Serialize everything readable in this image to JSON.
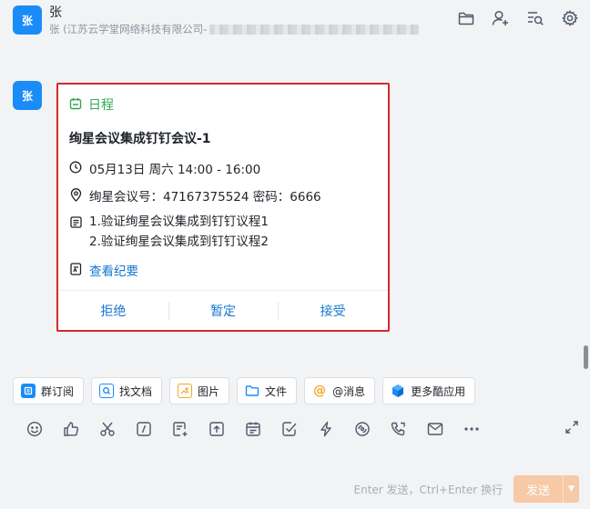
{
  "header": {
    "name": "张",
    "subtitle": "张 (江苏云学堂网络科技有限公司-",
    "avatar_text": "张",
    "icons": [
      "folder-icon",
      "add-user-icon",
      "search-history-icon",
      "settings-icon"
    ]
  },
  "message": {
    "avatar_text": "张",
    "card": {
      "type_label": "日程",
      "title": "绚星会议集成钉钉会议-1",
      "time": "05月13日 周六 14:00 - 16:00",
      "location": "绚星会议号：47167375524 密码：6666",
      "agenda": [
        "1.验证绚星会议集成到钉钉议程1",
        "2.验证绚星会议集成到钉钉议程2"
      ],
      "notes_link": "查看纪要",
      "actions": {
        "reject": "拒绝",
        "tentative": "暂定",
        "accept": "接受"
      }
    }
  },
  "quick_tools": [
    {
      "label": "群订阅",
      "icon": "subscribe-icon",
      "color": "#1a8cf8"
    },
    {
      "label": "找文档",
      "icon": "find-doc-icon",
      "color": "#1a8cf8"
    },
    {
      "label": "图片",
      "icon": "image-icon",
      "color": "#f5a623"
    },
    {
      "label": "文件",
      "icon": "file-icon",
      "color": "#1a8cf8"
    },
    {
      "label": "@消息",
      "icon": "mention-icon",
      "color": "#f5a623"
    },
    {
      "label": "更多酷应用",
      "icon": "apps-icon",
      "color": "#1a8cf8"
    }
  ],
  "toolbar_icons": [
    "emoji-icon",
    "thumbs-up-icon",
    "scissors-icon",
    "slash-command-icon",
    "new-note-icon",
    "upload-icon",
    "calendar-icon",
    "checkbox-icon",
    "lightning-icon",
    "link-icon",
    "phone-icon",
    "mail-icon",
    "more-icon"
  ],
  "footer": {
    "hint": "Enter 发送，Ctrl+Enter 换行",
    "send_label": "发送"
  },
  "colors": {
    "brand": "#1a8cf8",
    "link": "#1677d2",
    "schedule_green": "#34a853",
    "highlight_border": "#d9262c",
    "send_button": "#f7c9a6"
  }
}
